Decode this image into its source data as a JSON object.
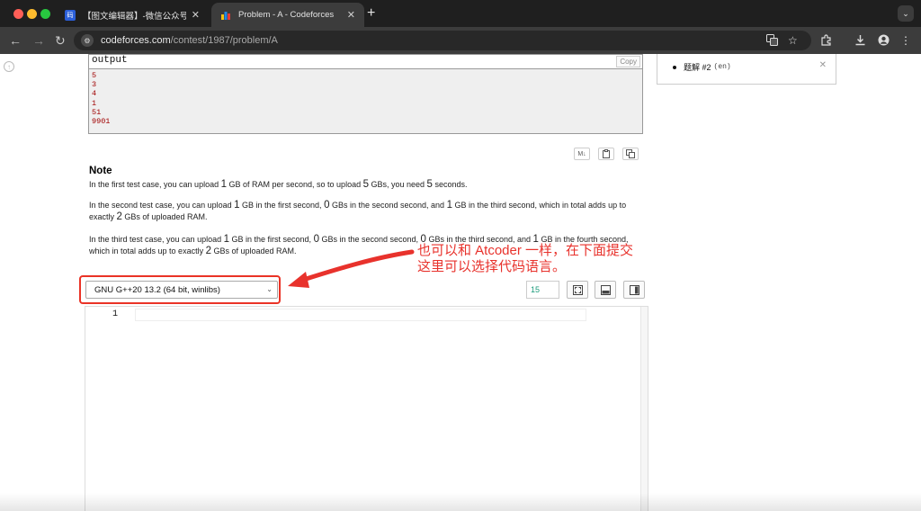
{
  "browser": {
    "tabs": [
      {
        "title": "【图文编辑器】-微信公众号图",
        "favicon_text": "码"
      },
      {
        "title": "Problem - A - Codeforces"
      }
    ],
    "url_host": "codeforces.com",
    "url_path": "/contest/1987/problem/A"
  },
  "output": {
    "title": "output",
    "copy_label": "Copy",
    "lines": [
      "5",
      "3",
      "4",
      "1",
      "51",
      "9901"
    ]
  },
  "toolbar_buttons": {
    "md": "M↓"
  },
  "note": {
    "title": "Note",
    "p1": {
      "a": "In the first test case, you can upload ",
      "b": "1",
      "c": " GB of RAM per second, so to upload ",
      "d": "5",
      "e": " GBs, you need ",
      "f": "5",
      "g": " seconds."
    },
    "p2": {
      "a": "In the second test case, you can upload ",
      "b": "1",
      "c": " GB in the first second, ",
      "d": "0",
      "e": " GBs in the second second, and ",
      "f": "1",
      "g": " GB in the third second, which in total adds up to exactly ",
      "h": "2",
      "i": " GBs of uploaded RAM."
    },
    "p3": {
      "a": "In the third test case, you can upload ",
      "b": "1",
      "c": " GB in the first second, ",
      "d": "0",
      "e": " GBs in the second second, ",
      "f": "0",
      "g": " GBs in the third second, and ",
      "h": "1",
      "i": " GB in the fourth second, which in total adds up to exactly ",
      "j": "2",
      "k": " GBs of uploaded RAM."
    }
  },
  "annotation": {
    "line1": "也可以和 Atcoder 一样，在下面提交",
    "line2": "这里可以选择代码语言。"
  },
  "editor": {
    "language": "GNU G++20 13.2 (64 bit, winlibs)",
    "font_size": "15",
    "line_number": "1"
  },
  "sidebar": {
    "item_label": "题解 #2",
    "item_lang": "(en)"
  },
  "colors": {
    "annotation_red": "#e8322c",
    "output_red": "#a00000",
    "chrome_dark": "#1f1f1f"
  }
}
